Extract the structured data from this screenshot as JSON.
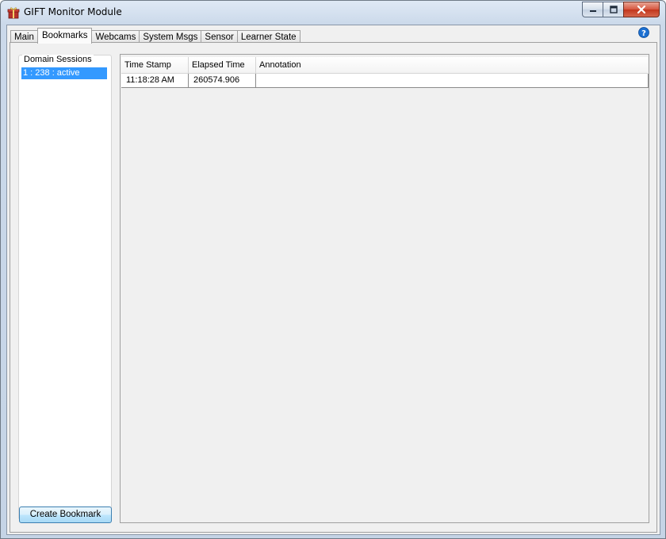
{
  "window": {
    "title": "GIFT Monitor Module",
    "app_icon": "gift-box-icon",
    "controls": [
      "minimize-icon",
      "maximize-icon",
      "close-icon"
    ]
  },
  "tabs": [
    {
      "label": "Main"
    },
    {
      "label": "Bookmarks",
      "selected": true
    },
    {
      "label": "Webcams"
    },
    {
      "label": "System Msgs"
    },
    {
      "label": "Sensor"
    },
    {
      "label": "Learner State"
    }
  ],
  "help_icon": "help-question-icon",
  "sessions": {
    "label": "Domain Sessions",
    "items": [
      "1 : 238 : active"
    ]
  },
  "create_bookmark_label": "Create Bookmark",
  "table": {
    "columns": [
      "Time Stamp",
      "Elapsed Time",
      "Annotation"
    ],
    "rows": [
      [
        "11:18:28 AM",
        "260574.906",
        ""
      ]
    ]
  },
  "colors": {
    "selection": "#3399ff",
    "close_button": "#c2361c",
    "help_icon": "#1b6fd1"
  }
}
